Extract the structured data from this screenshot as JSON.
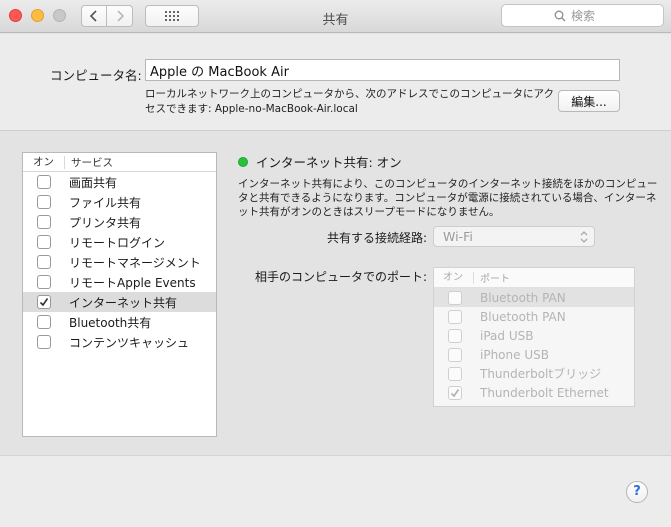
{
  "window": {
    "title": "共有"
  },
  "search": {
    "placeholder": "検索"
  },
  "computer_name": {
    "label": "コンピュータ名:",
    "value": "Apple の MacBook Air",
    "description": "ローカルネットワーク上のコンピュータから、次のアドレスでこのコンピュータにアクセスできます: Apple-no-MacBook-Air.local",
    "edit_label": "編集..."
  },
  "services": {
    "header_on": "オン",
    "header_service": "サービス",
    "items": [
      {
        "label": "画面共有",
        "checked": false
      },
      {
        "label": "ファイル共有",
        "checked": false
      },
      {
        "label": "プリンタ共有",
        "checked": false
      },
      {
        "label": "リモートログイン",
        "checked": false
      },
      {
        "label": "リモートマネージメント",
        "checked": false
      },
      {
        "label": "リモートApple Events",
        "checked": false
      },
      {
        "label": "インターネット共有",
        "checked": true,
        "selected": true
      },
      {
        "label": "Bluetooth共有",
        "checked": false
      },
      {
        "label": "コンテンツキャッシュ",
        "checked": false
      }
    ]
  },
  "detail": {
    "status": "インターネット共有: オン",
    "status_color": "#27c23a",
    "description": "インターネット共有により、このコンピュータのインターネット接続をほかのコンピュータと共有できるようになります。コンピュータが電源に接続されている場合、インターネット共有がオンのときはスリープモードになりません。",
    "connection_label": "共有する接続経路:",
    "connection_value": "Wi-Fi",
    "ports_label": "相手のコンピュータでのポート:",
    "ports_header_on": "オン",
    "ports_header_port": "ポート",
    "ports": [
      {
        "label": "Bluetooth PAN",
        "checked": false
      },
      {
        "label": "Bluetooth PAN",
        "checked": false
      },
      {
        "label": "iPad USB",
        "checked": false
      },
      {
        "label": "iPhone USB",
        "checked": false
      },
      {
        "label": "Thunderboltブリッジ",
        "checked": false
      },
      {
        "label": "Thunderbolt Ethernet",
        "checked": true
      }
    ]
  },
  "help": {
    "label": "?"
  }
}
